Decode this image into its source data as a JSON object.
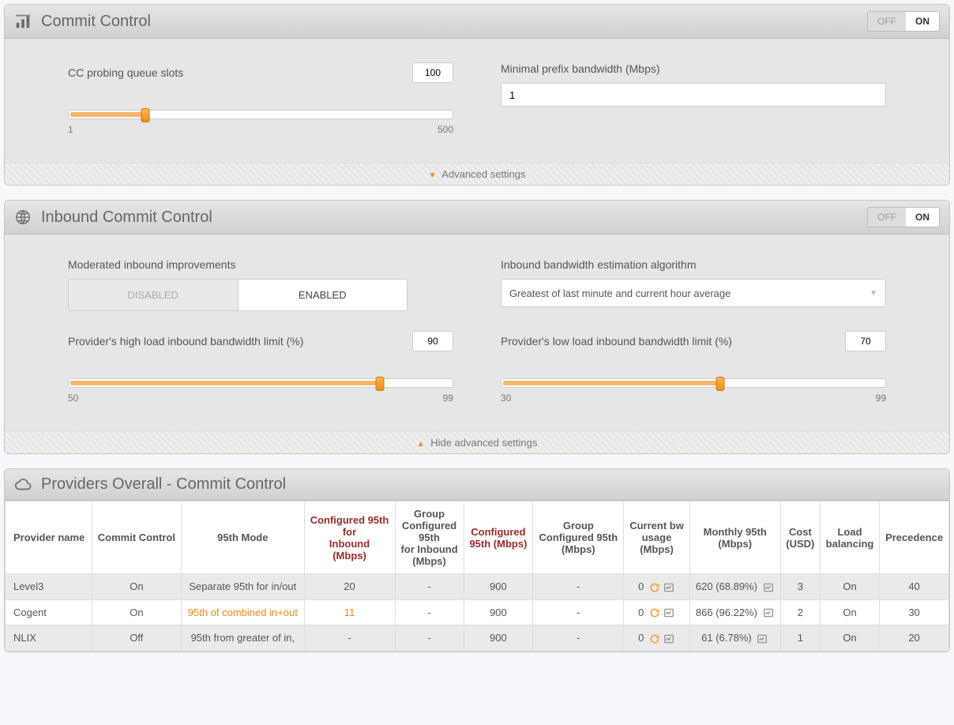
{
  "commit": {
    "title": "Commit Control",
    "toggle_off": "OFF",
    "toggle_on": "ON",
    "probing_label": "CC probing queue slots",
    "probing_value": "100",
    "probing_min": "1",
    "probing_max": "500",
    "probing_pct": 20,
    "minbw_label": "Minimal prefix bandwidth (Mbps)",
    "minbw_value": "1",
    "adv_label": "Advanced settings"
  },
  "inbound": {
    "title": "Inbound Commit Control",
    "toggle_off": "OFF",
    "toggle_on": "ON",
    "mod_label": "Moderated inbound improvements",
    "mod_disabled": "DISABLED",
    "mod_enabled": "ENABLED",
    "algo_label": "Inbound bandwidth estimation algorithm",
    "algo_value": "Greatest of last minute and current hour average",
    "high_label": "Provider's high load inbound bandwidth limit (%)",
    "high_value": "90",
    "high_min": "50",
    "high_max": "99",
    "high_pct": 81,
    "low_label": "Provider's low load inbound bandwidth limit (%)",
    "low_value": "70",
    "low_min": "30",
    "low_max": "99",
    "low_pct": 57,
    "hide_label": "Hide advanced settings"
  },
  "providers": {
    "title": "Providers Overall - Commit Control",
    "headers": {
      "name": "Provider name",
      "cc": "Commit Control",
      "mode": "95th Mode",
      "cfg_in": "Configured 95th\nfor Inbound (Mbps)",
      "grp_in": "Group Configured 95th\nfor Inbound (Mbps)",
      "cfg": "Configured 95th (Mbps)",
      "grp": "Group Configured 95th (Mbps)",
      "cur": "Current bw usage (Mbps)",
      "mon": "Monthly 95th (Mbps)",
      "cost": "Cost (USD)",
      "lb": "Load balancing",
      "prec": "Precedence"
    },
    "rows": [
      {
        "name": "Level3",
        "cc": "On",
        "mode": "Separate 95th for in/out",
        "mode_hl": false,
        "cfg_in": "20",
        "cfg_in_hl": false,
        "grp_in": "-",
        "cfg": "900",
        "grp": "-",
        "cur": "0",
        "mon": "620 (68.89%)",
        "cost": "3",
        "lb": "On",
        "prec": "40"
      },
      {
        "name": "Cogent",
        "cc": "On",
        "mode": "95th of combined in+out",
        "mode_hl": true,
        "cfg_in": "11",
        "cfg_in_hl": true,
        "grp_in": "-",
        "cfg": "900",
        "grp": "-",
        "cur": "0",
        "mon": "866 (96.22%)",
        "cost": "2",
        "lb": "On",
        "prec": "30"
      },
      {
        "name": "NLIX",
        "cc": "Off",
        "mode": "95th from greater of in,",
        "mode_hl": false,
        "cfg_in": "-",
        "cfg_in_hl": false,
        "grp_in": "-",
        "cfg": "900",
        "grp": "-",
        "cur": "0",
        "mon": "61 (6.78%)",
        "cost": "1",
        "lb": "On",
        "prec": "20"
      }
    ]
  }
}
